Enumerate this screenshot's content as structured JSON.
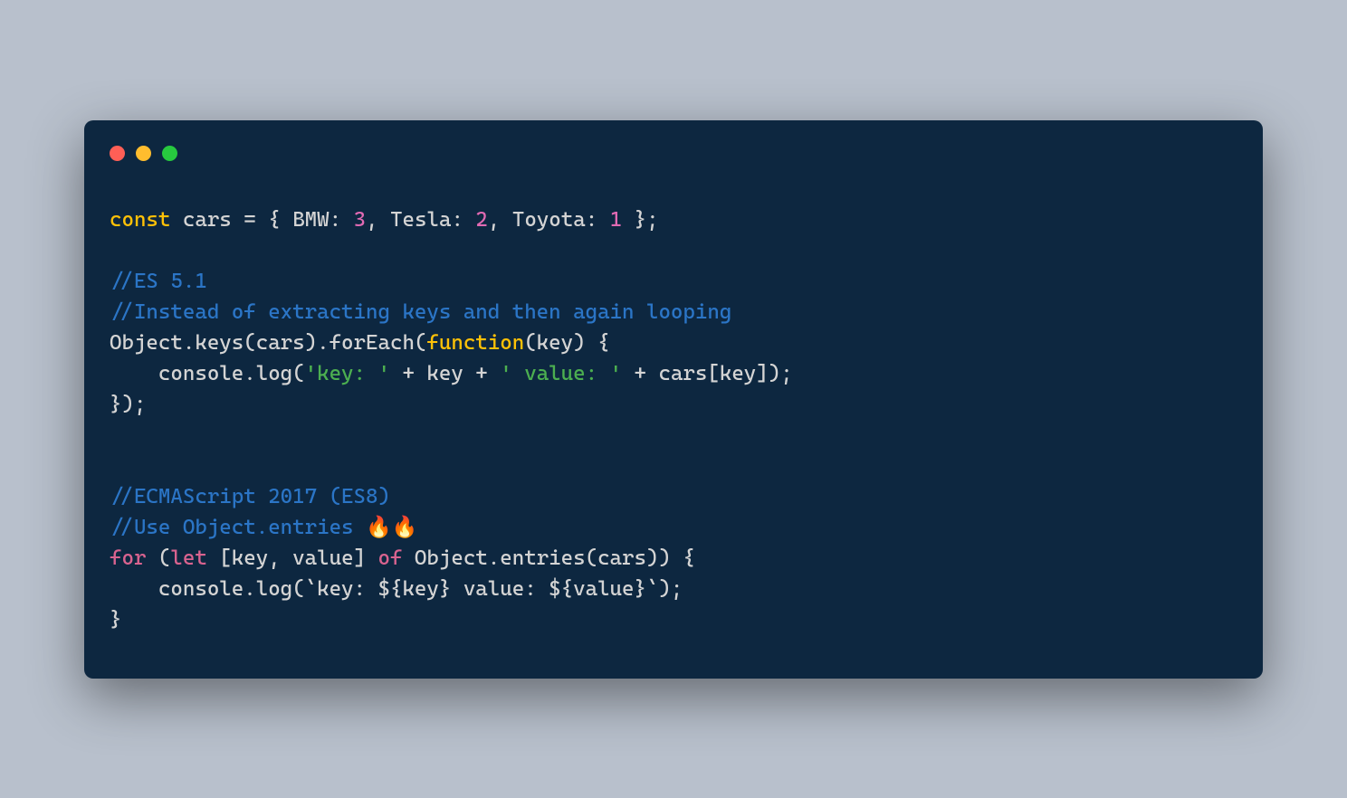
{
  "window": {
    "controls": {
      "close": "#ff5f56",
      "minimize": "#ffbd2e",
      "maximize": "#27c93f"
    }
  },
  "code": {
    "line1": {
      "const": "const",
      "sp1": " ",
      "var": "cars",
      "sp2": " ",
      "eq": "=",
      "sp3": " ",
      "lb": "{",
      "sp4": " ",
      "k1": "BMW",
      "c1": ":",
      "sp5": " ",
      "v1": "3",
      "com1": ",",
      "sp6": " ",
      "k2": "Tesla",
      "c2": ":",
      "sp7": " ",
      "v2": "2",
      "com2": ",",
      "sp8": " ",
      "k3": "Toyota",
      "c3": ":",
      "sp9": " ",
      "v3": "1",
      "sp10": " ",
      "rb": "}",
      "semi": ";"
    },
    "line3": "//ES 5.1",
    "line4": "//Instead of extracting keys and then again looping",
    "line5": {
      "p1": "Object.keys(cars).forEach(",
      "fn": "function",
      "p2": "(key) {"
    },
    "line6": {
      "indent": "    console.log(",
      "s1": "'key: '",
      "p1": " + key + ",
      "s2": "' value: '",
      "p2": " + cars[key]);"
    },
    "line7": "});",
    "line10": "//ECMAScript 2017 (ES8)",
    "line11": {
      "p1": "//Use Object.entries ",
      "fire": "🔥🔥"
    },
    "line12": {
      "for": "for",
      "sp1": " (",
      "let": "let",
      "sp2": " [key, value] ",
      "of": "of",
      "sp3": " Object.entries(cars)) {"
    },
    "line13": "    console.log(`key: ${key} value: ${value}`);",
    "line14": "}"
  }
}
